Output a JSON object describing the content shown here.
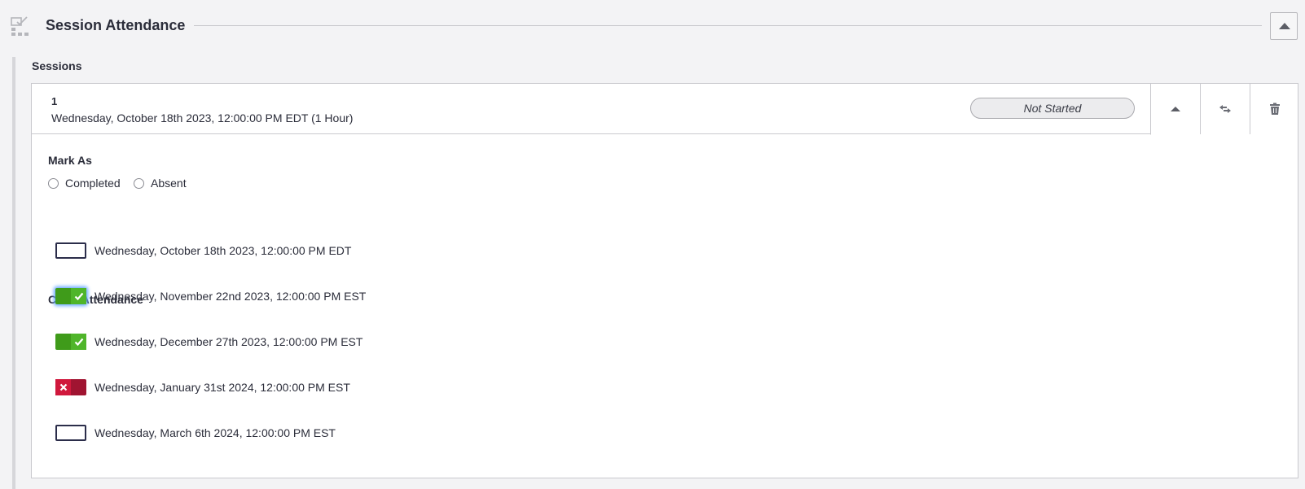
{
  "header": {
    "title": "Session Attendance",
    "icon": "checklist-icon"
  },
  "sessions_label": "Sessions",
  "session": {
    "number": "1",
    "datetime": "Wednesday, October 18th 2023, 12:00:00 PM EDT (1 Hour)",
    "status": "Not Started",
    "actions": [
      "collapse-up-icon",
      "move-arrows-icon",
      "trash-icon"
    ]
  },
  "mark_as": {
    "label": "Mark As",
    "options": [
      {
        "label": "Completed",
        "selected": false
      },
      {
        "label": "Absent",
        "selected": false
      }
    ]
  },
  "class_attendance": {
    "label": "Class Attendance",
    "rows": [
      {
        "date": "Wednesday, October 18th 2023, 12:00:00 PM EDT",
        "state": "unset"
      },
      {
        "date": "Wednesday, November 22nd 2023, 12:00:00 PM EST",
        "state": "present"
      },
      {
        "date": "Wednesday, December 27th 2023, 12:00:00 PM EST",
        "state": "present"
      },
      {
        "date": "Wednesday, January 31st 2024, 12:00:00 PM EST",
        "state": "absent"
      },
      {
        "date": "Wednesday, March 6th 2024, 12:00:00 PM EST",
        "state": "unset"
      }
    ]
  },
  "colors": {
    "present": "#4fb52a",
    "absent": "#d0183c",
    "unset_border": "#2b2d4a"
  }
}
